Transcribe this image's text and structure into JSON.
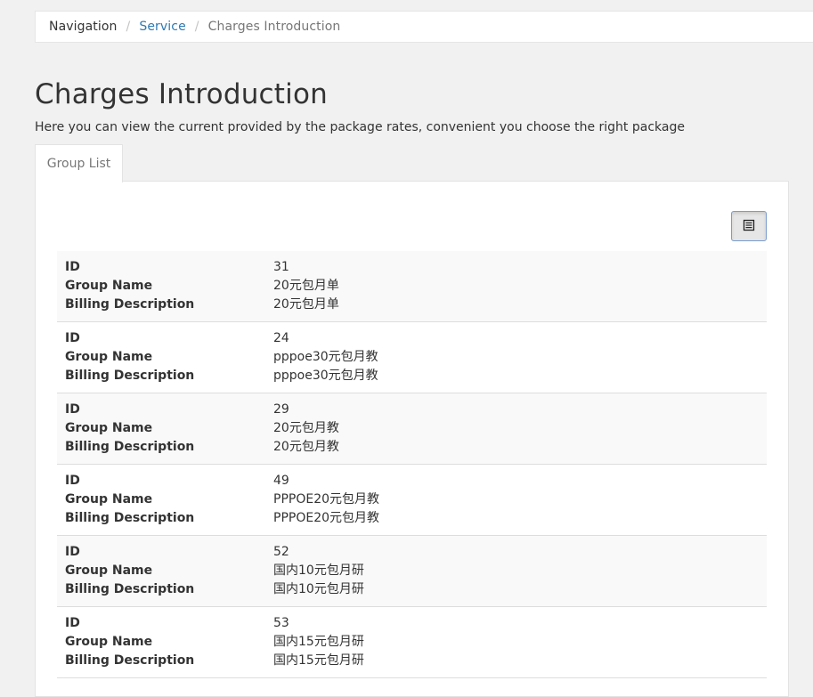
{
  "breadcrumb": {
    "root": "Navigation",
    "service": "Service",
    "current": "Charges Introduction",
    "separator": "/"
  },
  "page": {
    "title": "Charges Introduction",
    "description": "Here you can view the current provided by the package rates, convenient you choose the right package"
  },
  "tabs": [
    {
      "label": "Group List",
      "active": true
    }
  ],
  "toolbar": {
    "view_toggle_icon": "list-view-icon"
  },
  "labels": {
    "id": "ID",
    "group_name": "Group Name",
    "billing_description": "Billing Description"
  },
  "groups": [
    {
      "id": "31",
      "name": "20元包月单",
      "billing": "20元包月单"
    },
    {
      "id": "24",
      "name": "pppoe30元包月教",
      "billing": "pppoe30元包月教"
    },
    {
      "id": "29",
      "name": "20元包月教",
      "billing": "20元包月教"
    },
    {
      "id": "49",
      "name": "PPPOE20元包月教",
      "billing": "PPPOE20元包月教"
    },
    {
      "id": "52",
      "name": "国内10元包月研",
      "billing": "国内10元包月研"
    },
    {
      "id": "53",
      "name": "国内15元包月研",
      "billing": "国内15元包月研"
    }
  ],
  "colors": {
    "link": "#2f7ab3",
    "page_bg": "#f1f1f1",
    "stripe": "#f9f9f9"
  }
}
